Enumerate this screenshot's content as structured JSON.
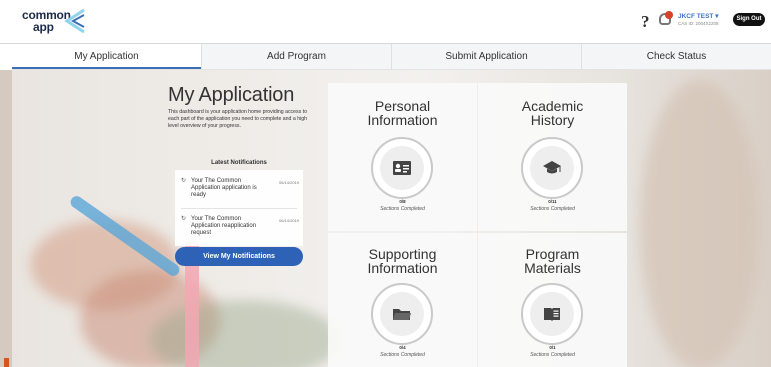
{
  "header": {
    "logo_line1": "common",
    "logo_line2": "app",
    "help_label": "?",
    "user_name": "JKCF TEST",
    "user_caret": "▾",
    "user_id": "CAS ID: 2004X2208",
    "signout_label": "Sign Out"
  },
  "tabs": [
    "My Application",
    "Add Program",
    "Submit Application",
    "Check Status"
  ],
  "intro": {
    "title": "My Application",
    "description": "This dashboard is your application home providing access to each part of the application you need to complete and a high level overview of your progress."
  },
  "notifications": {
    "title": "Latest Notifications",
    "items": [
      {
        "text": "Your The Common Application application is ready",
        "date": "06/14/2019"
      },
      {
        "text": "Your The Common Application reapplication request",
        "date": "06/14/2019"
      }
    ],
    "button_label": "View My Notifications"
  },
  "cards": [
    {
      "title_line1": "Personal",
      "title_line2": "Information",
      "count": "0/8",
      "subtitle": "Sections Completed",
      "icon": "id-card-icon"
    },
    {
      "title_line1": "Academic",
      "title_line2": "History",
      "count": "0/11",
      "subtitle": "Sections Completed",
      "icon": "graduation-cap-icon"
    },
    {
      "title_line1": "Supporting",
      "title_line2": "Information",
      "count": "0/4",
      "subtitle": "Sections Completed",
      "icon": "folder-icon"
    },
    {
      "title_line1": "Program",
      "title_line2": "Materials",
      "count": "0/1",
      "subtitle": "Sections Completed",
      "icon": "book-icon"
    }
  ],
  "colors": {
    "accent": "#2d62b6",
    "brand_dark": "#1c2b4a",
    "notification_dot": "#d9412a"
  }
}
